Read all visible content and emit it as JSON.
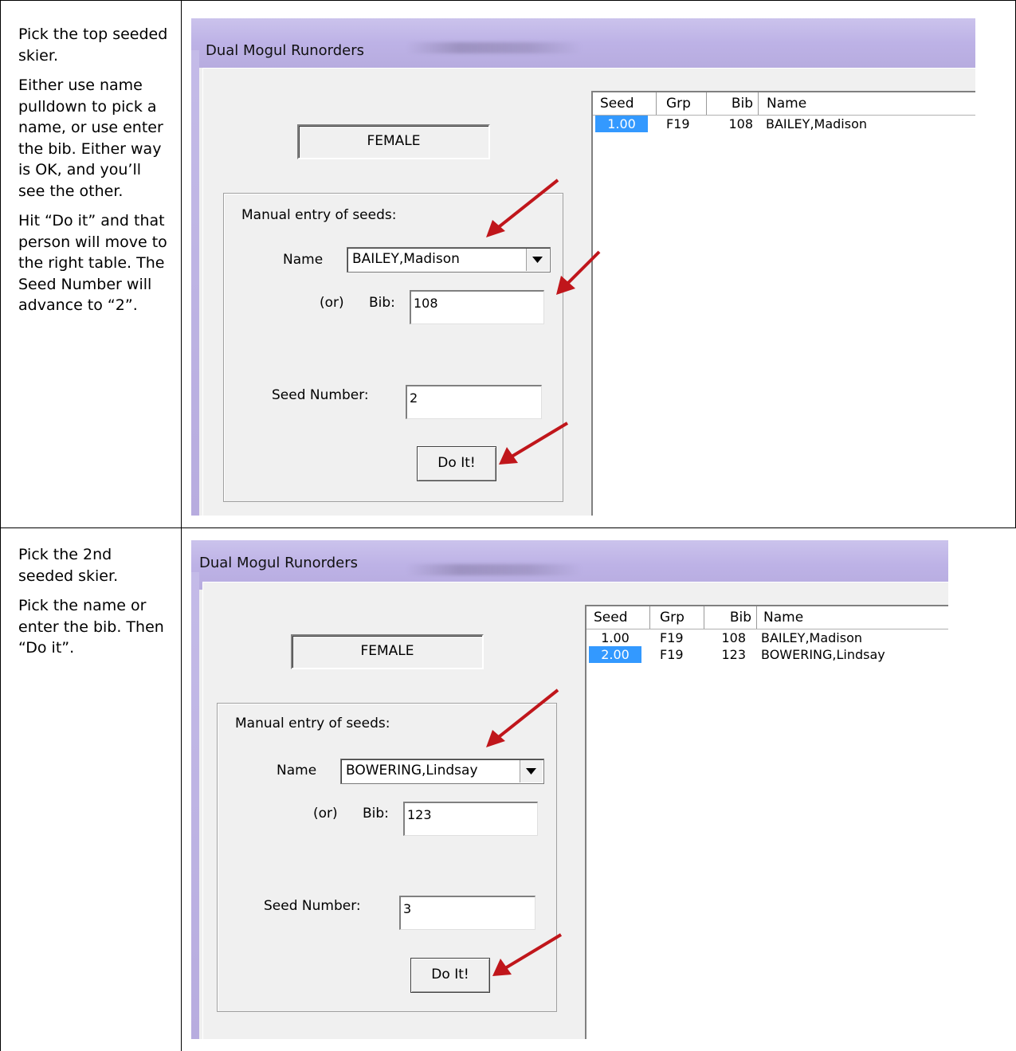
{
  "rows": [
    {
      "description": [
        "Pick the top seeded skier.",
        "Either use name pulldown to pick a name, or use enter the bib. Either way is OK, and you’ll see the other.",
        "Hit “Do it” and that person will move to the right table. The Seed Number will advance to “2”."
      ],
      "window": {
        "title": "Dual Mogul Runorders",
        "gender_label": "FEMALE",
        "group_label": "Manual entry of seeds:",
        "name_label": "Name",
        "name_value": "BAILEY,Madison",
        "or_label": "(or)",
        "bib_label": "Bib:",
        "bib_value": "108",
        "seed_label": "Seed Number:",
        "seed_value": "2",
        "do_it_label": "Do It!",
        "columns": [
          "Seed",
          "Grp",
          "Bib",
          "Name"
        ],
        "entries": [
          {
            "seed": "1.00",
            "grp": "F19",
            "bib": "108",
            "name": "BAILEY,Madison",
            "selected": true
          }
        ]
      }
    },
    {
      "description": [
        "Pick the 2nd seeded skier.",
        "Pick the name or enter the bib. Then “Do it”."
      ],
      "window": {
        "title": "Dual Mogul Runorders",
        "gender_label": "FEMALE",
        "group_label": "Manual entry of seeds:",
        "name_label": "Name",
        "name_value": "BOWERING,Lindsay",
        "or_label": "(or)",
        "bib_label": "Bib:",
        "bib_value": "123",
        "seed_label": "Seed Number:",
        "seed_value": "3",
        "do_it_label": "Do It!",
        "columns": [
          "Seed",
          "Grp",
          "Bib",
          "Name"
        ],
        "entries": [
          {
            "seed": "1.00",
            "grp": "F19",
            "bib": "108",
            "name": "BAILEY,Madison",
            "selected": false
          },
          {
            "seed": "2.00",
            "grp": "F19",
            "bib": "123",
            "name": "BOWERING,Lindsay",
            "selected": true
          }
        ]
      }
    }
  ],
  "colors": {
    "selection": "#3399ff",
    "titlebar": "#bdb2e6",
    "arrow": "#c0161b"
  }
}
